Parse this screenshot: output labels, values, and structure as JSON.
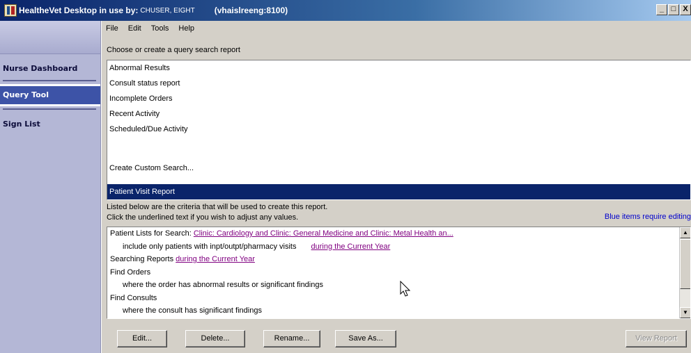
{
  "window": {
    "app_name": "HealtheVet Desktop in use by:",
    "user": "CHUSER, EIGHT",
    "server": "(vhaislreeng:8100)",
    "buttons": {
      "minimize": "_",
      "maximize": "□",
      "close": "X"
    }
  },
  "sidebar": {
    "items": [
      {
        "label": "Nurse Dashboard",
        "active": false
      },
      {
        "label": "Query Tool",
        "active": true
      },
      {
        "label": "Sign List",
        "active": false
      }
    ]
  },
  "menu": {
    "file": "File",
    "edit": "Edit",
    "tools": "Tools",
    "help": "Help"
  },
  "query_section": {
    "caption": "Choose or create a query search report",
    "reports": [
      "Abnormal Results",
      "Consult status report",
      "Incomplete Orders",
      "Recent Activity",
      "Scheduled/Due Activity",
      "",
      "Create Custom Search...",
      "",
      "Patient Visit Report"
    ],
    "selected_index": 8
  },
  "criteria_section": {
    "caption_line1": "Listed below are the criteria that will be used to create this report.",
    "caption_line2": "Click the underlined text if you wish to adjust any values.",
    "blue_note": "Blue items require editing",
    "lines": {
      "l1_text": "Patient Lists for Search: ",
      "l1_link": "Clinic: Cardiology and Clinic: General Medicine and Clinic: Metal Health an...",
      "l2_text": "include only patients with inpt/outpt/pharmacy visits",
      "l2_link": "during the Current Year",
      "l3_text": "Searching Reports ",
      "l3_link": "during the Current Year",
      "l4_text": "Find Orders",
      "l5_text": "where the order has abnormal results or significant findings",
      "l6_text": "Find Consults",
      "l7_text": "where the consult has significant findings"
    }
  },
  "buttons": {
    "edit": "Edit...",
    "delete": "Delete...",
    "rename": "Rename...",
    "save_as": "Save As...",
    "view_report": "View Report"
  },
  "colors": {
    "title_bar": "#0a246a",
    "sidebar_bg": "#b4b7d6",
    "active_nav": "#3d53a7",
    "selection": "#0a246a",
    "link": "#800080",
    "note": "#0000cc"
  }
}
